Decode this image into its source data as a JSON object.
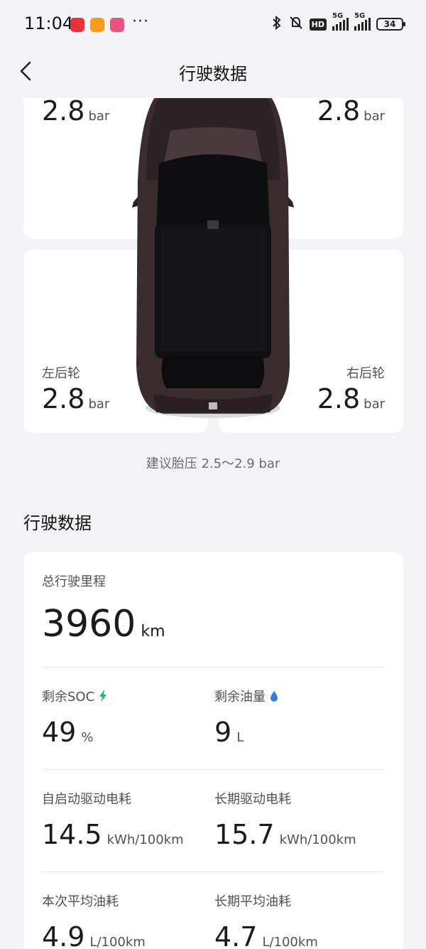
{
  "status_bar": {
    "time": "11:04",
    "dots": "···",
    "network_1": "5G",
    "network_2": "5G",
    "hd": "HD",
    "battery": "34"
  },
  "header": {
    "title": "行驶数据"
  },
  "tires": {
    "front_left": {
      "label": "",
      "value": "2.8",
      "unit": "bar"
    },
    "front_right": {
      "label": "",
      "value": "2.8",
      "unit": "bar"
    },
    "rear_left": {
      "label": "左后轮",
      "value": "2.8",
      "unit": "bar"
    },
    "rear_right": {
      "label": "右后轮",
      "value": "2.8",
      "unit": "bar"
    },
    "hint": "建议胎压 2.5～2.9 bar"
  },
  "driving": {
    "section_title": "行驶数据",
    "total_mileage": {
      "label": "总行驶里程",
      "value": "3960",
      "unit": "km"
    },
    "soc": {
      "label": "剩余SOC",
      "value": "49",
      "unit": "%"
    },
    "fuel": {
      "label": "剩余油量",
      "value": "9",
      "unit": "L"
    },
    "trip_power": {
      "label": "自启动驱动电耗",
      "value": "14.5",
      "unit": "kWh/100km"
    },
    "long_power": {
      "label": "长期驱动电耗",
      "value": "15.7",
      "unit": "kWh/100km"
    },
    "trip_fuel": {
      "label": "本次平均油耗",
      "value": "4.9",
      "unit": "L/100km"
    },
    "long_fuel": {
      "label": "长期平均油耗",
      "value": "4.7",
      "unit": "L/100km"
    }
  },
  "colors": {
    "soc_bolt": "#1fb96a",
    "fuel_drop": "#3a7bd5"
  }
}
